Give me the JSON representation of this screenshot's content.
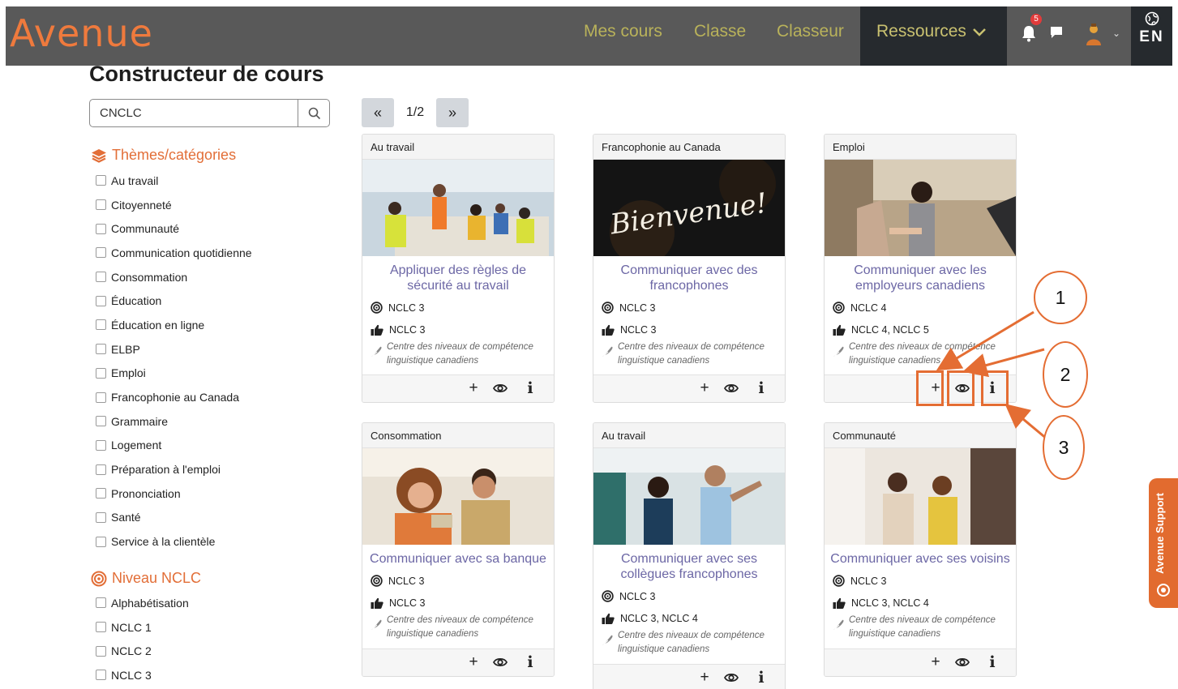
{
  "navbar": {
    "logo": "Avenue",
    "links": [
      "Mes cours",
      "Classe",
      "Classeur"
    ],
    "resources_label": "Ressources",
    "notification_count": "5",
    "language": "EN"
  },
  "page": {
    "title": "Constructeur de cours"
  },
  "search": {
    "value": "CNCLC",
    "placeholder": ""
  },
  "filters": {
    "themes_title": "Thèmes/catégories",
    "themes": [
      "Au travail",
      "Citoyenneté",
      "Communauté",
      "Communication quotidienne",
      "Consommation",
      "Éducation",
      "Éducation en ligne",
      "ELBP",
      "Emploi",
      "Francophonie au Canada",
      "Grammaire",
      "Logement",
      "Préparation à l'emploi",
      "Prononciation",
      "Santé",
      "Service à la clientèle"
    ],
    "levels_title": "Niveau NCLC",
    "levels": [
      "Alphabétisation",
      "NCLC 1",
      "NCLC 2",
      "NCLC 3"
    ]
  },
  "pagination": {
    "current": "1/2",
    "prev_icon": "double-chevron-left-icon",
    "next_icon": "double-chevron-right-icon"
  },
  "cards": [
    {
      "category": "Au travail",
      "title": "Appliquer des règles de sécurité au travail",
      "target_level": "NCLC 3",
      "recommended_level": "NCLC 3",
      "provider": "Centre des niveaux de compétence linguistique canadiens"
    },
    {
      "category": "Francophonie au Canada",
      "title": "Communiquer avec des francophones",
      "target_level": "NCLC 3",
      "recommended_level": "NCLC 3",
      "provider": "Centre des niveaux de compétence linguistique canadiens"
    },
    {
      "category": "Emploi",
      "title": "Communiquer avec les employeurs canadiens",
      "target_level": "NCLC 4",
      "recommended_level": "NCLC 4, NCLC 5",
      "provider": "Centre des niveaux de compétence linguistique canadiens"
    },
    {
      "category": "Consommation",
      "title": "Communiquer avec sa banque",
      "target_level": "NCLC 3",
      "recommended_level": "NCLC 3",
      "provider": "Centre des niveaux de compétence linguistique canadiens"
    },
    {
      "category": "Au travail",
      "title": "Communiquer avec ses collègues francophones",
      "target_level": "NCLC 3",
      "recommended_level": "NCLC 3, NCLC 4",
      "provider": "Centre des niveaux de compétence linguistique canadiens"
    },
    {
      "category": "Communauté",
      "title": "Communiquer avec ses voisins",
      "target_level": "NCLC 3",
      "recommended_level": "NCLC 3, NCLC 4",
      "provider": "Centre des niveaux de compétence linguistique canadiens"
    }
  ],
  "card_actions": {
    "add": "+",
    "info": "i"
  },
  "image_texts": {
    "bienvenue": "Bienvenue!"
  },
  "annotations": [
    "1",
    "2",
    "3"
  ],
  "support": {
    "label": "Avenue Support"
  },
  "colors": {
    "accent": "#e26e37",
    "navbar": "#595959",
    "nav_active": "#262a2e",
    "nav_link": "#b9b25a",
    "card_title": "#6c67a5",
    "annotation": "#e46d33"
  }
}
